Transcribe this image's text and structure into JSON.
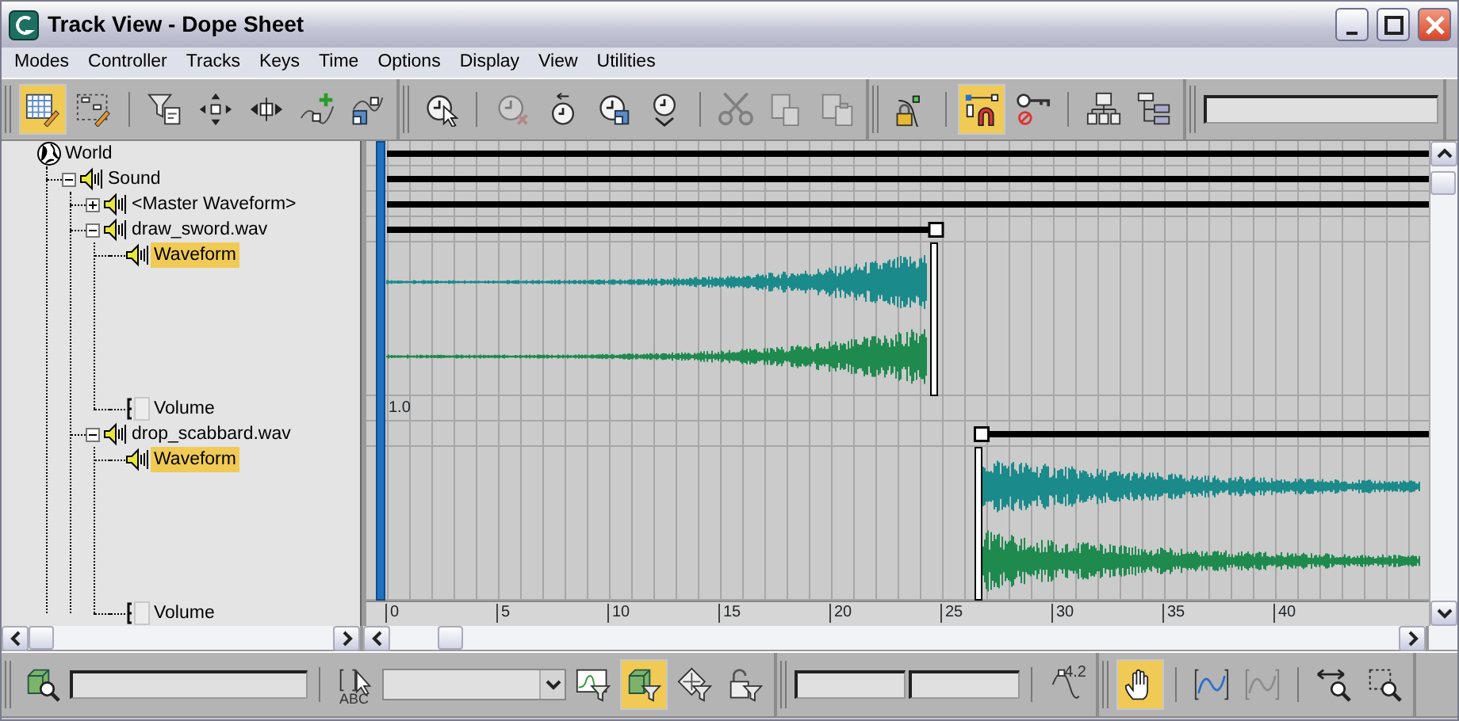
{
  "window": {
    "title": "Track View - Dope Sheet"
  },
  "menu": [
    "Modes",
    "Controller",
    "Tracks",
    "Keys",
    "Time",
    "Options",
    "Display",
    "View",
    "Utilities"
  ],
  "top_toolbar": [
    {
      "groups": [
        [
          {
            "kind": "button",
            "selected": true,
            "disabled": false
          },
          {
            "kind": "button",
            "selected": false,
            "disabled": false
          }
        ],
        [
          {
            "kind": "button",
            "selected": false,
            "disabled": false
          },
          {
            "kind": "button",
            "selected": false,
            "disabled": false
          },
          {
            "kind": "button",
            "selected": false,
            "disabled": false
          },
          {
            "kind": "button",
            "selected": false,
            "disabled": false
          },
          {
            "kind": "button",
            "selected": false,
            "disabled": false
          }
        ]
      ]
    },
    {
      "groups": [
        [
          {
            "kind": "button",
            "selected": false,
            "disabled": false
          }
        ],
        [
          {
            "kind": "button",
            "selected": false,
            "disabled": true
          },
          {
            "kind": "button",
            "selected": false,
            "disabled": false
          },
          {
            "kind": "button",
            "selected": false,
            "disabled": false
          },
          {
            "kind": "button",
            "selected": false,
            "disabled": false
          }
        ],
        [
          {
            "kind": "button",
            "selected": false,
            "disabled": true
          },
          {
            "kind": "button",
            "selected": false,
            "disabled": true
          },
          {
            "kind": "button",
            "selected": false,
            "disabled": true
          }
        ]
      ]
    },
    {
      "groups": [
        [
          {
            "kind": "button",
            "selected": false,
            "disabled": false
          }
        ],
        [
          {
            "kind": "button",
            "selected": true,
            "disabled": false
          },
          {
            "kind": "button",
            "selected": false,
            "disabled": false
          }
        ],
        [
          {
            "kind": "button",
            "selected": false,
            "disabled": false
          },
          {
            "kind": "button",
            "selected": false,
            "disabled": false
          }
        ]
      ]
    },
    {
      "groups": [
        [
          {
            "kind": "field"
          }
        ]
      ]
    }
  ],
  "tree": [
    {
      "label": "World",
      "kind": "world",
      "selected": false,
      "children": [
        {
          "label": "Sound",
          "kind": "sound",
          "expanded": true,
          "selected": false,
          "children": [
            {
              "label": "<Master Waveform>",
              "kind": "sound",
              "expanded": false,
              "selected": false
            },
            {
              "label": "draw_sword.wav",
              "kind": "sound",
              "expanded": true,
              "selected": false,
              "children": [
                {
                  "label": "Waveform",
                  "kind": "wave",
                  "selected": true
                },
                {
                  "label": "Volume",
                  "kind": "volume",
                  "selected": false
                }
              ]
            },
            {
              "label": "drop_scabbard.wav",
              "kind": "sound",
              "expanded": true,
              "selected": false,
              "children": [
                {
                  "label": "Waveform",
                  "kind": "wave",
                  "selected": true
                },
                {
                  "label": "Volume",
                  "kind": "volume",
                  "selected": false
                }
              ]
            }
          ]
        }
      ]
    }
  ],
  "tracks": [
    {
      "kind": "bar"
    },
    {
      "kind": "bar"
    },
    {
      "kind": "bar"
    },
    {
      "kind": "range-end"
    },
    {
      "kind": "swell"
    },
    {
      "kind": "value",
      "label": "1.0"
    },
    {
      "kind": "range-start"
    },
    {
      "kind": "decay"
    }
  ],
  "time_slider": {
    "level": 0
  },
  "ruler": {
    "labels": [
      "0",
      "5",
      "10",
      "15",
      "20",
      "25",
      "30",
      "35",
      "40"
    ]
  },
  "bottom_toolbar": [
    {
      "groups": [
        [
          {
            "kind": "button",
            "selected": false,
            "disabled": false
          },
          {
            "kind": "field"
          }
        ],
        [
          {
            "kind": "button",
            "selected": false,
            "disabled": false,
            "label": "ABC"
          },
          {
            "kind": "dropdown"
          },
          {
            "kind": "button",
            "selected": false,
            "disabled": false
          },
          {
            "kind": "button",
            "selected": true,
            "disabled": false
          },
          {
            "kind": "button",
            "selected": false,
            "disabled": false
          },
          {
            "kind": "button",
            "selected": false,
            "disabled": false
          }
        ]
      ]
    },
    {
      "groups": [
        [
          {
            "kind": "field"
          },
          {
            "kind": "field"
          }
        ],
        [
          {
            "kind": "button",
            "selected": false,
            "disabled": false,
            "label": "4.2"
          }
        ]
      ]
    },
    {
      "groups": [
        [
          {
            "kind": "button",
            "selected": true,
            "disabled": false
          }
        ],
        [
          {
            "kind": "button",
            "selected": false,
            "disabled": false
          },
          {
            "kind": "button",
            "selected": false,
            "disabled": true
          }
        ],
        [
          {
            "kind": "button",
            "selected": false,
            "disabled": false
          },
          {
            "kind": "button",
            "selected": false,
            "disabled": false
          }
        ]
      ]
    }
  ]
}
